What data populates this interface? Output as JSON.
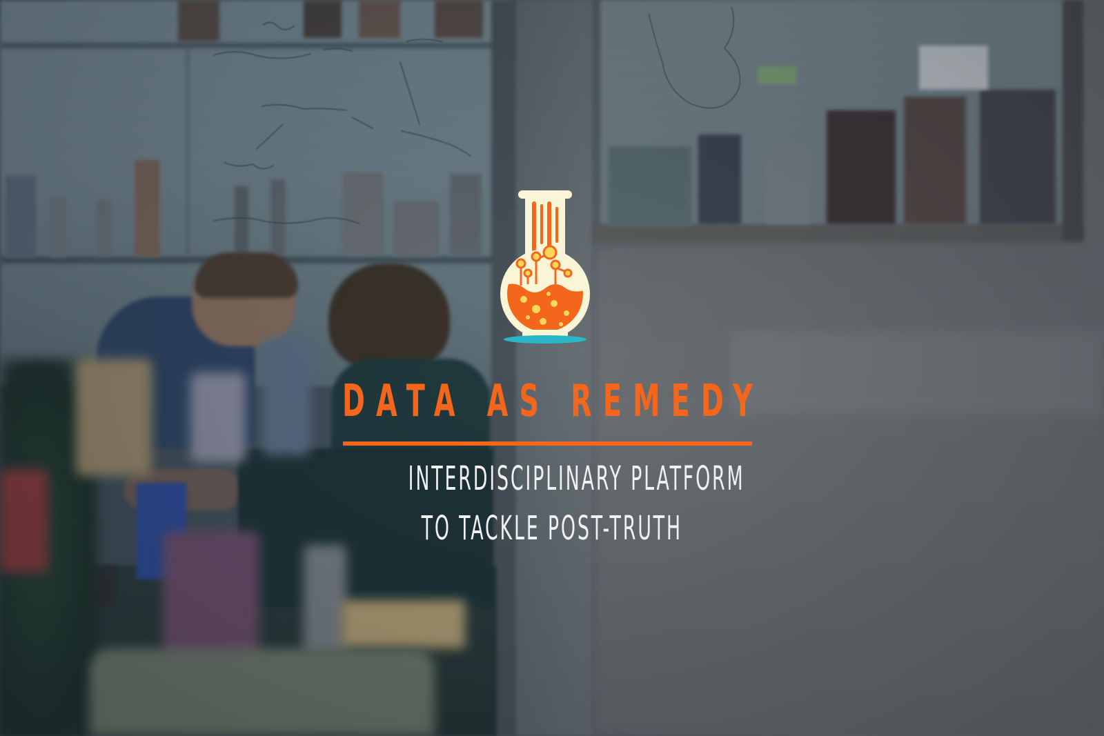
{
  "brand": {
    "title": "DATA AS REMEDY",
    "subtitle_line1": "INTERDISCIPLINARY PLATFORM",
    "subtitle_line2": "TO TACKLE POST-TRUTH",
    "logo_icon": "flask-icon"
  },
  "colors": {
    "accent": "#f4661b",
    "text_light": "#f1f1f1",
    "flask_glass": "#fbf5d8",
    "flask_base": "#2ab8c9"
  }
}
